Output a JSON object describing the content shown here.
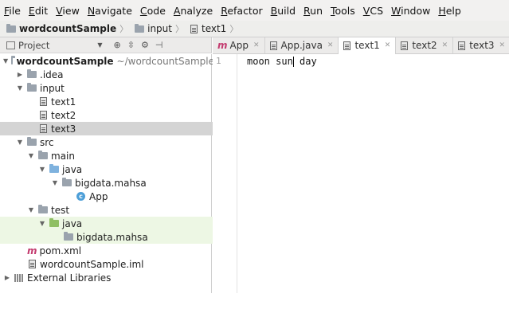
{
  "menu": [
    "File",
    "Edit",
    "View",
    "Navigate",
    "Code",
    "Analyze",
    "Refactor",
    "Build",
    "Run",
    "Tools",
    "VCS",
    "Window",
    "Help"
  ],
  "breadcrumb": {
    "project": "wordcountSample",
    "folder": "input",
    "file": "text1"
  },
  "project_panel": {
    "title": "Project"
  },
  "tree": {
    "root": {
      "name": "wordcountSample",
      "path": "~/wordcountSample"
    },
    "idea": ".idea",
    "input": "input",
    "text1": "text1",
    "text2": "text2",
    "text3": "text3",
    "src": "src",
    "main": "main",
    "java_main": "java",
    "pkg_main": "bigdata.mahsa",
    "app_class": "App",
    "test": "test",
    "java_test": "java",
    "pkg_test": "bigdata.mahsa",
    "pom": "pom.xml",
    "iml": "wordcountSample.iml",
    "ext_libs": "External Libraries"
  },
  "tabs": [
    {
      "label": "App"
    },
    {
      "label": "App.java"
    },
    {
      "label": "text1"
    },
    {
      "label": "text2"
    },
    {
      "label": "text3"
    }
  ],
  "editor": {
    "line_number": "1",
    "text_before_caret": "moon sun",
    "text_after_caret": " day"
  }
}
